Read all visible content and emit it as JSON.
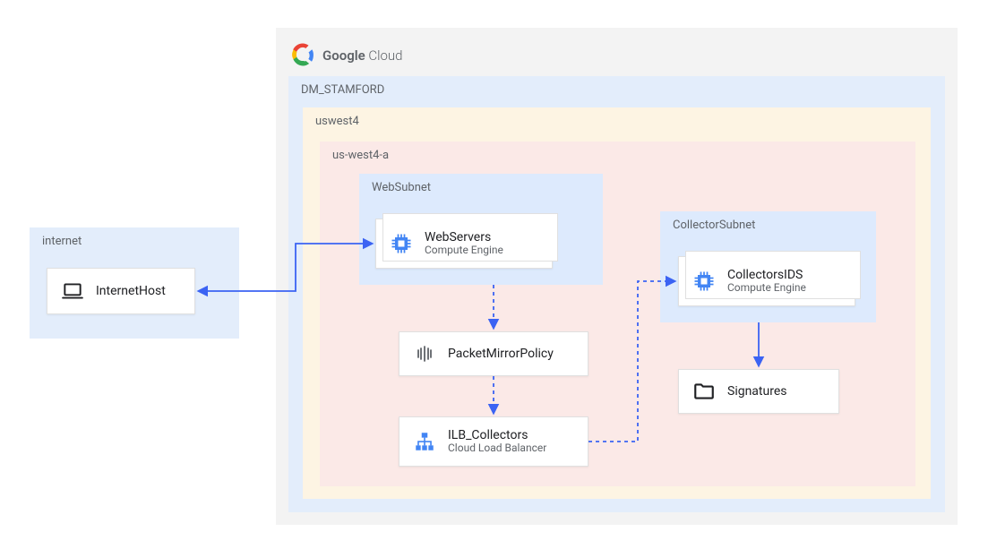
{
  "header": {
    "brand_bold": "Google",
    "brand_light": " Cloud"
  },
  "containers": {
    "internet": "internet",
    "project": "DM_STAMFORD",
    "region": "uswest4",
    "zone": "us-west4-a",
    "websubnet": "WebSubnet",
    "collectorsubnet": "CollectorSubnet"
  },
  "nodes": {
    "internet_host": {
      "title": "InternetHost"
    },
    "webservers": {
      "title": "WebServers",
      "sub": "Compute Engine"
    },
    "packet_mirror": {
      "title": "PacketMirrorPolicy"
    },
    "ilb": {
      "title": "ILB_Collectors",
      "sub": "Cloud Load Balancer"
    },
    "collectors_ids": {
      "title": "CollectorsIDS",
      "sub": "Compute Engine"
    },
    "signatures": {
      "title": "Signatures"
    }
  },
  "colors": {
    "grey_bg": "#f3f3f3",
    "blue_bg": "#e3edfb",
    "cream_bg": "#fdf4e3",
    "pink_bg": "#fbe9e7",
    "blue_subnet": "#ddeafd",
    "stroke": "#3b63f3",
    "text_grey": "#5f6368"
  },
  "icons": {
    "cloud": "google-cloud-logo-icon",
    "laptop": "laptop-icon",
    "compute": "compute-engine-icon",
    "mirror": "packet-mirror-icon",
    "lb": "load-balancer-icon",
    "folder": "folder-icon"
  }
}
